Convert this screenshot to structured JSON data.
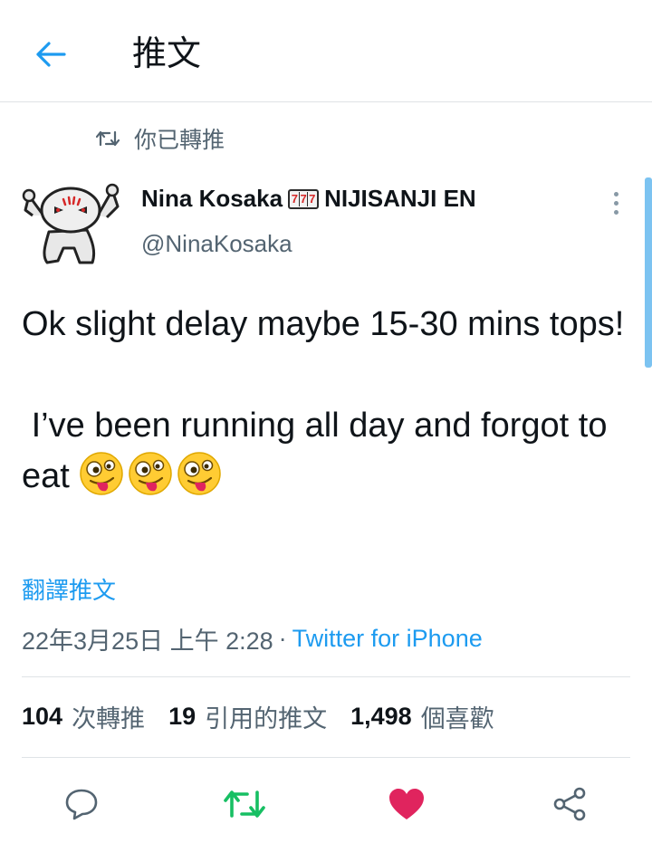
{
  "header": {
    "title": "推文",
    "back_icon": "arrow-left-icon"
  },
  "retweet_context": {
    "icon": "retweet-icon",
    "text": "你已轉推"
  },
  "author": {
    "name": "Nina Kosaka",
    "name_suffix": "NIJISANJI EN",
    "slot_badge": [
      "7",
      "7",
      "7"
    ],
    "handle": "@NinaKosaka"
  },
  "tweet": {
    "line1": "Ok slight delay maybe 15-30 mins tops!",
    "line2": " I’ve been running all day and forgot to eat",
    "emoji": "zany-face-emoji",
    "emoji_count": 3
  },
  "translate_label": "翻譯推文",
  "meta": {
    "timestamp": "22年3月25日 上午 2:28",
    "separator": "·",
    "source": "Twitter for iPhone"
  },
  "stats": {
    "retweets_count": "104",
    "retweets_label": "次轉推",
    "quotes_count": "19",
    "quotes_label": "引用的推文",
    "likes_count": "1,498",
    "likes_label": "個喜歡"
  },
  "actions": {
    "reply_icon": "comment-icon",
    "retweet_icon": "retweet-icon",
    "like_icon": "heart-icon",
    "share_icon": "share-icon"
  },
  "colors": {
    "accent": "#1d9bf0",
    "retweet_green": "#17bf63",
    "like_pink": "#e0245e",
    "secondary_text": "#536471"
  }
}
